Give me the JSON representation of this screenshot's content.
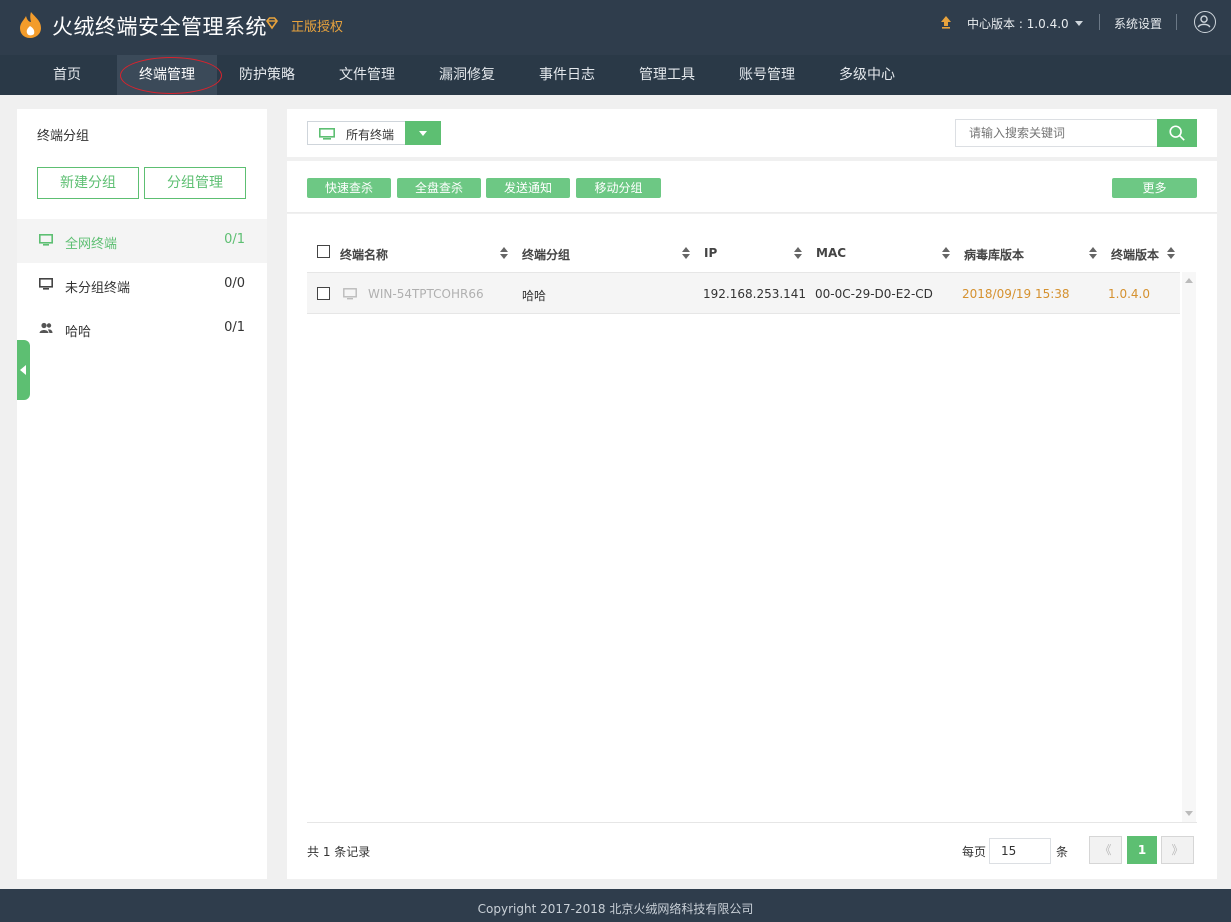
{
  "header": {
    "app_title": "火绒终端安全管理系统",
    "license_label": "正版授权",
    "version_label": "中心版本 : 1.0.4.0",
    "settings_label": "系统设置",
    "colors": {
      "bar": "#2f3d4c",
      "accent": "#5dbf72",
      "license": "#e8a33d"
    }
  },
  "nav": {
    "items": [
      "首页",
      "终端管理",
      "防护策略",
      "文件管理",
      "漏洞修复",
      "事件日志",
      "管理工具",
      "账号管理",
      "多级中心"
    ],
    "active": "终端管理"
  },
  "sidebar": {
    "title": "终端分组",
    "new_group_label": "新建分组",
    "manage_group_label": "分组管理",
    "groups": [
      {
        "name": "全网终端",
        "count": "0/1",
        "icon": "monitor-icon",
        "active": true
      },
      {
        "name": "未分组终端",
        "count": "0/0",
        "icon": "monitor-icon",
        "active": false
      },
      {
        "name": "哈哈",
        "count": "0/1",
        "icon": "users-icon",
        "active": false
      }
    ]
  },
  "toolbar": {
    "filter_label": "所有终端",
    "search_placeholder": "请输入搜索关键词",
    "actions": [
      "快速查杀",
      "全盘查杀",
      "发送通知",
      "移动分组"
    ],
    "more_label": "更多"
  },
  "table": {
    "columns": [
      "终端名称",
      "终端分组",
      "IP",
      "MAC",
      "病毒库版本",
      "终端版本"
    ],
    "rows": [
      {
        "name": "WIN-54TPTCOHR66",
        "group": "哈哈",
        "ip": "192.168.253.141",
        "mac": "00-0C-29-D0-E2-CD",
        "virus_db": "2018/09/19 15:38",
        "version": "1.0.4.0"
      }
    ]
  },
  "pagination": {
    "record_count": "共 1 条记录",
    "per_page_label": "每页",
    "per_page_value": "15",
    "per_page_unit": "条",
    "prev_label": "《",
    "current_page": "1",
    "next_label": "》"
  },
  "footer": {
    "copyright": "Copyright 2017-2018 北京火绒网络科技有限公司"
  }
}
